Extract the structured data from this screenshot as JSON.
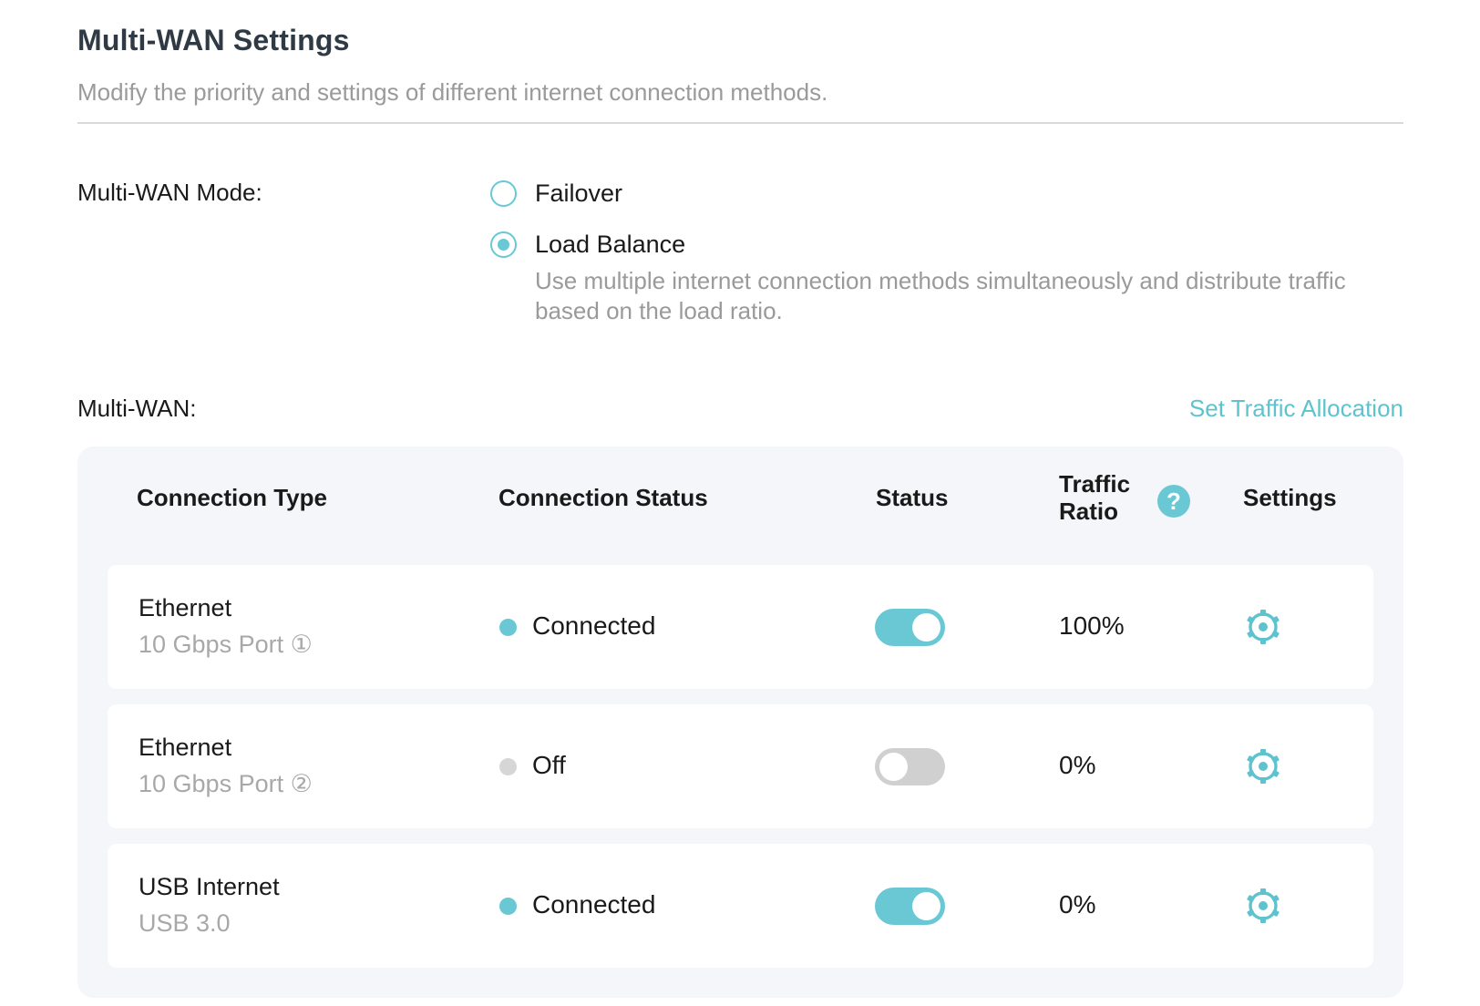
{
  "header": {
    "title": "Multi-WAN Settings",
    "subtitle": "Modify the priority and settings of different internet connection methods."
  },
  "mode": {
    "label": "Multi-WAN Mode:",
    "options": [
      {
        "label": "Failover",
        "selected": false
      },
      {
        "label": "Load Balance",
        "selected": true
      }
    ],
    "selected_description": "Use multiple internet connection methods simultaneously and distribute traffic based on the load ratio."
  },
  "multiwan": {
    "label": "Multi-WAN:",
    "traffic_link": "Set Traffic Allocation",
    "columns": {
      "type": "Connection Type",
      "connection_status": "Connection Status",
      "status": "Status",
      "ratio": "Traffic Ratio",
      "settings": "Settings"
    },
    "help_icon": "?",
    "rows": [
      {
        "name": "Ethernet",
        "port": "10 Gbps Port ①",
        "connection_status": "Connected",
        "enabled": true,
        "ratio": "100%"
      },
      {
        "name": "Ethernet",
        "port": "10 Gbps Port ②",
        "connection_status": "Off",
        "enabled": false,
        "ratio": "0%"
      },
      {
        "name": "USB Internet",
        "port": "USB 3.0",
        "connection_status": "Connected",
        "enabled": true,
        "ratio": "0%"
      }
    ]
  },
  "colors": {
    "accent": "#69c8d3",
    "link": "#5ec3cf",
    "muted_text": "#9a9a9a",
    "off_dot": "#d6d6d6",
    "panel_bg": "#f5f6f9"
  },
  "icons": {
    "row_settings": "gear-icon",
    "ratio_help": "help-icon"
  }
}
